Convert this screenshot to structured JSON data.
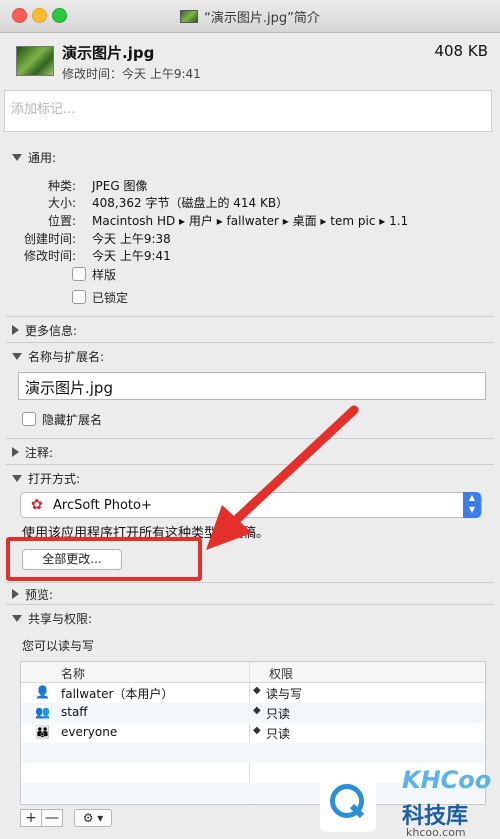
{
  "window": {
    "title": "“演示图片.jpg”简介"
  },
  "header": {
    "filename": "演示图片.jpg",
    "size": "408 KB",
    "modified": "修改时间：今天 上午9:41"
  },
  "tags": {
    "placeholder": "添加标记..."
  },
  "general": {
    "section_label": "通用:",
    "kind_label": "种类:",
    "kind_value": "JPEG 图像",
    "size_label": "大小:",
    "size_value": "408,362 字节（磁盘上的 414 KB）",
    "where_label": "位置:",
    "where_value": "Macintosh HD ▸ 用户 ▸ fallwater ▸ 桌面 ▸ tem pic ▸ 1.1",
    "created_label": "创建时间:",
    "created_value": "今天 上午9:38",
    "modified_label": "修改时间:",
    "modified_value": "今天 上午9:41",
    "stationery_label": "样版",
    "locked_label": "已锁定"
  },
  "more_info": {
    "section_label": "更多信息:"
  },
  "name_ext": {
    "section_label": "名称与扩展名:",
    "name_value": "演示图片.jpg",
    "hide_ext_label": "隐藏扩展名"
  },
  "comments": {
    "section_label": "注释:"
  },
  "open_with": {
    "section_label": "打开方式:",
    "app_name": "ArcSoft Photo+",
    "app_icon": "flower-icon",
    "description": "使用该应用程序打开所有这种类型的文稿。",
    "change_all_label": "全部更改..."
  },
  "preview": {
    "section_label": "预览:"
  },
  "sharing": {
    "section_label": "共享与权限:",
    "status": "您可以读与写",
    "col_name": "名称",
    "col_privilege": "权限",
    "rows": [
      {
        "name": "fallwater（本用户）",
        "privilege": "读与写",
        "icon": "user-icon"
      },
      {
        "name": "staff",
        "privilege": "只读",
        "icon": "group-icon"
      },
      {
        "name": "everyone",
        "privilege": "只读",
        "icon": "everyone-icon"
      }
    ],
    "add_label": "+",
    "remove_label": "—",
    "action_label": "⚙ ▾"
  },
  "watermark": {
    "logo": "KHCoo",
    "name": "科技库",
    "url": "khcoo.com"
  },
  "colors": {
    "highlight": "#e3302a",
    "accent": "#3e7de8"
  }
}
